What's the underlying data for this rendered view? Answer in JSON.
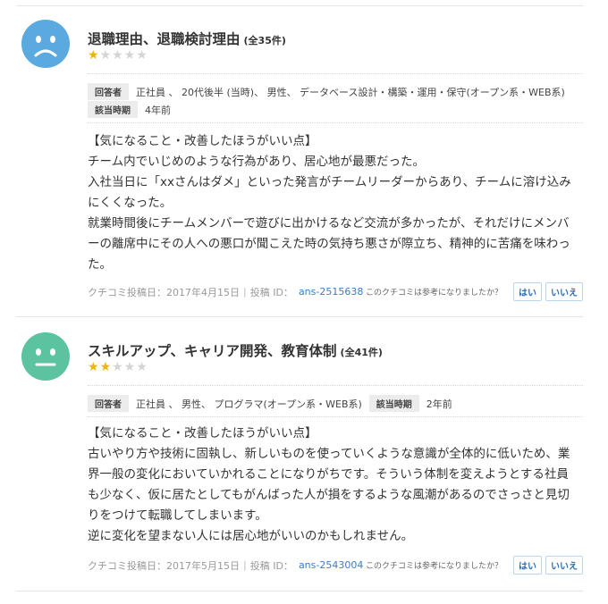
{
  "reviews": [
    {
      "title": "退職理由、退職検討理由",
      "count": "(全35件)",
      "rating": 1,
      "face": "sad",
      "face_color": "#5aa9df",
      "respondent_label": "回答者",
      "respondent": "正社員 、 20代後半 (当時)、 男性、 データベース設計・構築・運用・保守(オープン系・WEB系)",
      "period_label": "該当時期",
      "period": "4年前",
      "lines": [
        "【気になること・改善したほうがいい点】",
        "チーム内でいじめのような行為があり、居心地が最悪だった。",
        "入社当日に「xxさんはダメ」といった発言がチームリーダーからあり、チームに溶け込み",
        "にくくなった。",
        "就業時間後にチームメンバーで遊びに出かけるなど交流が多かったが、それだけにメンバ",
        "ーの離席中にその人への悪口が聞こえた時の気持ち悪さが際立ち、精神的に苦痛を味わっ",
        "た。"
      ],
      "posted": "クチコミ投稿日：2017年4月15日",
      "post_id_label": "投稿 ID：",
      "post_id": "ans-2515638",
      "helpful_q": "このクチコミは参考になりましたか？",
      "yes": "はい",
      "no": "いいえ"
    },
    {
      "title": "スキルアップ、キャリア開発、教育体制",
      "count": "(全41件)",
      "rating": 2,
      "face": "neutral",
      "face_color": "#5cc3a0",
      "respondent_label": "回答者",
      "respondent": "正社員 、 男性、 プログラマ(オープン系・WEB系)",
      "period_label": "該当時期",
      "period": "2年前",
      "lines": [
        "【気になること・改善したほうがいい点】",
        "古いやり方や技術に固執し、新しいものを使っていくような意識が全体的に低いため、業",
        "界一般の変化においていかれることになりがちです。そういう体制を変えようとする社員",
        "も少なく、仮に居たとしてもがんばった人が損をするような風潮があるのでさっさと見切",
        "りをつけて転職してしまいます。",
        "逆に変化を望まない人には居心地がいいのかもしれません。"
      ],
      "posted": "クチコミ投稿日：2017年5月15日",
      "post_id_label": "投稿 ID：",
      "post_id": "ans-2543004",
      "helpful_q": "このクチコミは参考になりましたか？",
      "yes": "はい",
      "no": "いいえ"
    }
  ]
}
